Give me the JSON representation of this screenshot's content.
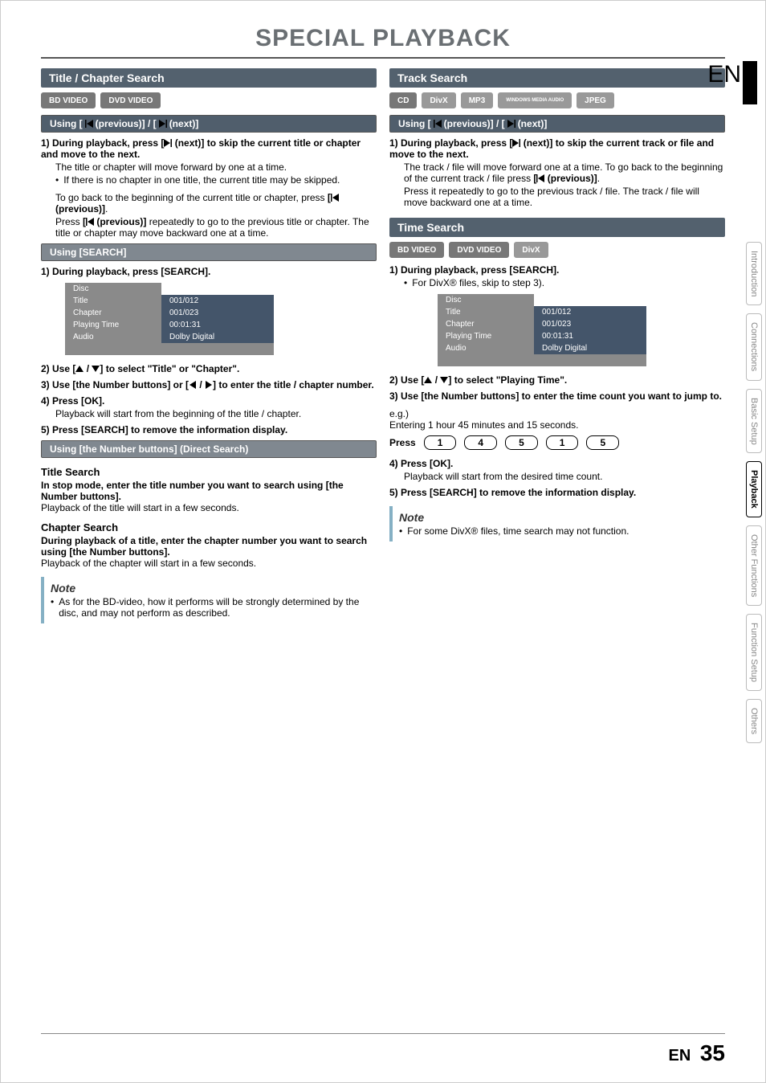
{
  "page": {
    "title": "SPECIAL PLAYBACK",
    "lang_marker": "EN",
    "footer_lang": "EN",
    "page_number": "35"
  },
  "tabs": [
    "Introduction",
    "Connections",
    "Basic Setup",
    "Playback",
    "Other Functions",
    "Function Setup",
    "Others"
  ],
  "left": {
    "section_title": "Title / Chapter Search",
    "badges": [
      "BD VIDEO",
      "DVD VIDEO"
    ],
    "subbar1": {
      "pre": "Using [",
      "mid": " (previous)] / [",
      "post": " (next)]"
    },
    "step1_a": "1)  During playback, press [",
    "step1_b": " (next)] to skip the current title or chapter and move to the next.",
    "step1_note1": "The title or chapter will move forward by one at a time.",
    "step1_bullet": "If there is no chapter in one title, the current title may be skipped.",
    "step1_note2a": "To go back to the beginning of the current title or chapter, press ",
    "step1_note2b": "[",
    "step1_note2c": " (previous)]",
    "step1_note2d": ".",
    "step1_note3a": "Press ",
    "step1_note3b": "[",
    "step1_note3c": " (previous)]",
    "step1_note3d": " repeatedly to go to the previous title or chapter. The title or chapter may move backward one at a time.",
    "subbar2": "Using [SEARCH]",
    "search_step1": "1)  During playback, press [SEARCH].",
    "osd": {
      "rows": [
        {
          "label": "Disc",
          "value": ""
        },
        {
          "label": "Title",
          "value": "001/012"
        },
        {
          "label": "Chapter",
          "value": "001/023"
        },
        {
          "label": "Playing Time",
          "value": "00:01:31"
        },
        {
          "label": "Audio",
          "value": "Dolby Digital"
        }
      ]
    },
    "search_step2a": "2)  Use [",
    "search_step2b": " / ",
    "search_step2c": "] to select \"Title\" or \"Chapter\".",
    "search_step3a": "3)  Use [the Number buttons] or [",
    "search_step3b": " / ",
    "search_step3c": "] to enter the title / chapter number.",
    "search_step4": "4)  Press [OK].",
    "search_step4_note": "Playback will start from the beginning of the title / chapter.",
    "search_step5": "5)  Press [SEARCH] to remove the information display.",
    "subbar3": "Using [the Number buttons] (Direct Search)",
    "ts_head": "Title Search",
    "ts_bold": "In stop mode, enter the title number you want to search using [the Number buttons].",
    "ts_txt": "Playback of the title will start in a few seconds.",
    "cs_head": "Chapter Search",
    "cs_bold": "During playback of a title, enter the chapter number you want to search using [the Number buttons].",
    "cs_txt": "Playback of the chapter will start in a few seconds.",
    "note_title": "Note",
    "note_txt": "As for the BD-video, how it performs will be strongly determined by the disc, and may not perform as described."
  },
  "right": {
    "section_title": "Track Search",
    "badges": [
      "CD",
      "DivX",
      "MP3",
      "WINDOWS MEDIA AUDIO",
      "JPEG"
    ],
    "subbar1": {
      "pre": "Using [",
      "mid": " (previous)] / [",
      "post": " (next)]"
    },
    "step1_a": "1)  During playback, press [",
    "step1_b": " (next)] to skip the current track or file and move to the next.",
    "step1_note1a": "The track / file will move forward one at a time. To go back to the beginning of the current track / file press ",
    "step1_note1b": "[",
    "step1_note1c": " (previous)]",
    "step1_note1d": ".",
    "step1_note2": "Press it repeatedly to go to the previous track / file. The track / file will move backward one at a time.",
    "section2_title": "Time Search",
    "badges2": [
      "BD VIDEO",
      "DVD VIDEO",
      "DivX"
    ],
    "ts_step1": "1)  During playback, press [SEARCH].",
    "ts_step1_bullet": "For DivX® files, skip to step 3).",
    "osd": {
      "rows": [
        {
          "label": "Disc",
          "value": ""
        },
        {
          "label": "Title",
          "value": "001/012"
        },
        {
          "label": "Chapter",
          "value": "001/023"
        },
        {
          "label": "Playing Time",
          "value": "00:01:31"
        },
        {
          "label": "Audio",
          "value": "Dolby Digital"
        }
      ]
    },
    "ts_step2a": "2)  Use [",
    "ts_step2b": " / ",
    "ts_step2c": "] to select \"Playing Time\".",
    "ts_step3": "3)  Use [the Number buttons] to enter the time count you want to jump to.",
    "eg_label": "e.g.)",
    "eg_txt": "Entering 1 hour 45 minutes and 15 seconds.",
    "press_label": "Press",
    "press_keys": [
      "1",
      "4",
      "5",
      "1",
      "5"
    ],
    "ts_step4": "4)  Press [OK].",
    "ts_step4_note": "Playback will start from the desired time count.",
    "ts_step5": "5)  Press [SEARCH] to remove the information display.",
    "note_title": "Note",
    "note_txt": "For some DivX® files, time search may not function."
  }
}
